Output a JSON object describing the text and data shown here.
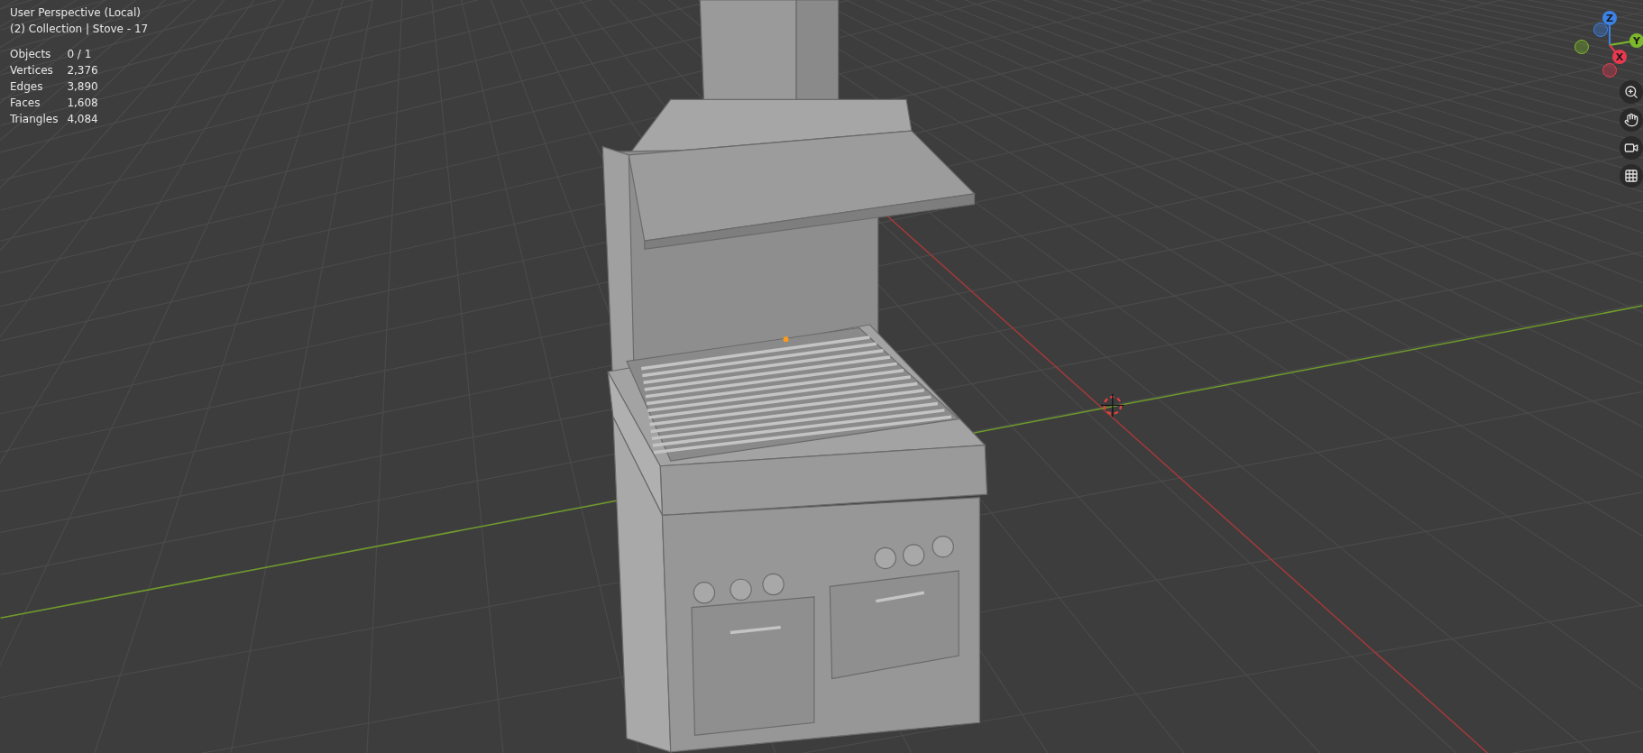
{
  "viewport": {
    "view_name": "User Perspective (Local)",
    "object_info": "(2) Collection | Stove - 17",
    "stats": [
      {
        "label": "Objects",
        "value": "0 / 1"
      },
      {
        "label": "Vertices",
        "value": "2,376"
      },
      {
        "label": "Edges",
        "value": "3,890"
      },
      {
        "label": "Faces",
        "value": "1,608"
      },
      {
        "label": "Triangles",
        "value": "4,084"
      }
    ]
  },
  "gizmo": {
    "axes": [
      {
        "label": "Z",
        "color": "#3b82e8"
      },
      {
        "label": "Y",
        "color": "#7cb82b"
      },
      {
        "label": "X",
        "color": "#e8394f"
      }
    ]
  }
}
